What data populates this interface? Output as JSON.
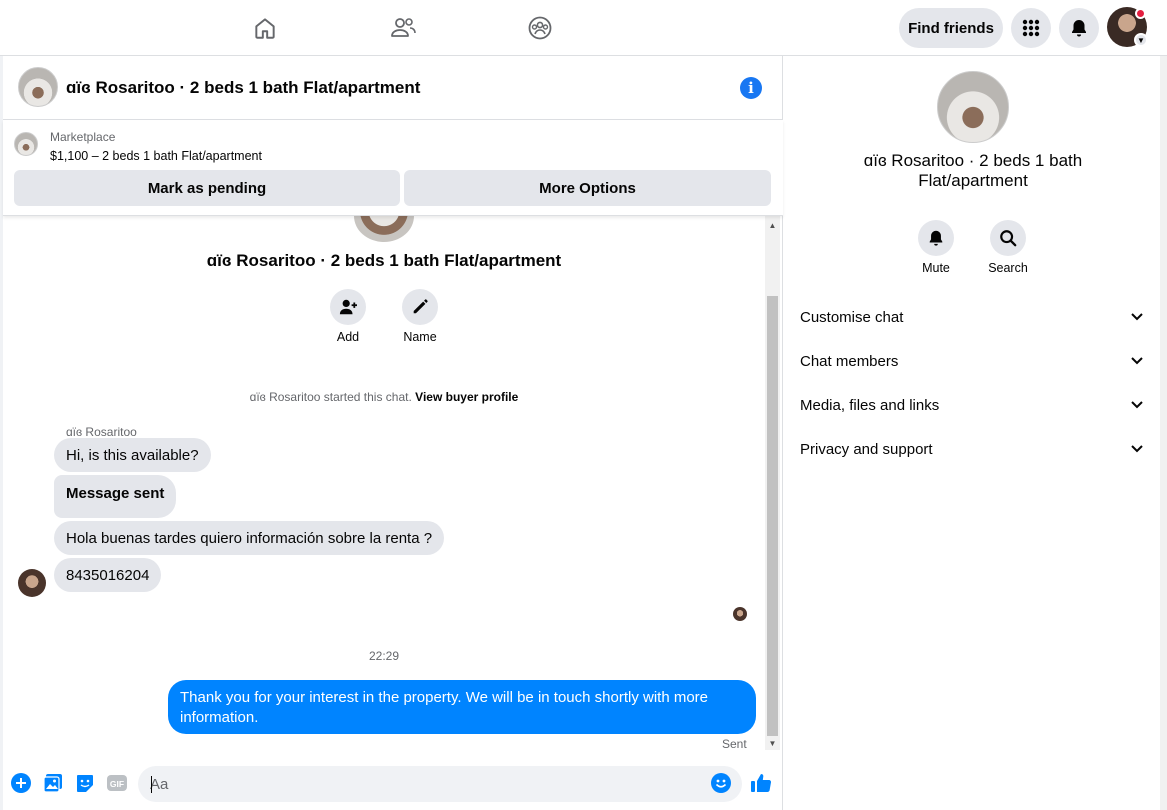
{
  "topnav": {
    "nav_icons": [
      "home-icon",
      "friends-icon",
      "groups-icon"
    ],
    "find_friends_label": "Find friends",
    "menu_icon": "grid-menu-icon",
    "notifications_icon": "bell-icon"
  },
  "chat": {
    "header_title": "ɑïɞ Rosaritoo · 2 beds 1 bath Flat/apartment",
    "marketplace_label": "Marketplace",
    "listing_price_title": "$1,100 – 2 beds 1 bath Flat/apartment",
    "mark_pending_label": "Mark as pending",
    "more_options_label": "More Options",
    "thread_title": "ɑïɞ Rosaritoo · 2 beds 1 bath Flat/apartment",
    "actions": [
      {
        "icon": "add-person-icon",
        "label": "Add"
      },
      {
        "icon": "pencil-icon",
        "label": "Name"
      }
    ],
    "started_text": "ɑïɞ Rosaritoo started this chat.",
    "view_buyer_profile": "View buyer profile",
    "sender_name": "ɑïɞ Rosaritoo",
    "incoming_messages": [
      "Hi, is this available?",
      "Message sent",
      "Hola buenas tardes quiero información sobre la renta ?",
      "8435016204"
    ],
    "timestamp": "22:29",
    "outgoing_message": "Thank you for your interest in the property. We will be in touch shortly with more information.",
    "sent_status": "Sent",
    "composer_placeholder": "Aa",
    "colors": {
      "outgoing_bubble": "#0084ff",
      "accent": "#1877f2",
      "incoming_bubble": "#e4e6eb"
    }
  },
  "right_panel": {
    "title": "ɑïɞ Rosaritoo · 2 beds 1 bath Flat/apartment",
    "actions": [
      {
        "icon": "bell-icon",
        "label": "Mute"
      },
      {
        "icon": "search-icon",
        "label": "Search"
      }
    ],
    "sections": [
      "Customise chat",
      "Chat members",
      "Media, files and links",
      "Privacy and support"
    ]
  }
}
